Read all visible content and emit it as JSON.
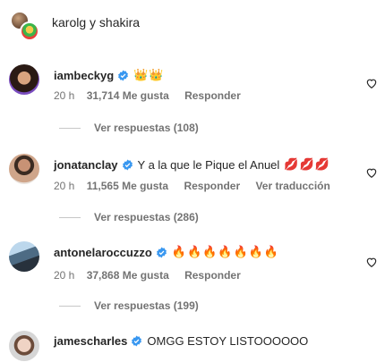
{
  "header": {
    "title": "karolg y shakira"
  },
  "comments": [
    {
      "username": "iambeckyg",
      "text": "",
      "emoji": "👑👑",
      "time": "20 h",
      "likes": "31,714 Me gusta",
      "reply": "Responder",
      "translate": "",
      "replies": "Ver respuestas (108)"
    },
    {
      "username": "jonatanclay",
      "text": "Y a la que le Pique el Anuel",
      "emoji": "💋💋💋",
      "time": "20 h",
      "likes": "11,565 Me gusta",
      "reply": "Responder",
      "translate": "Ver traducción",
      "replies": "Ver respuestas (286)"
    },
    {
      "username": "antonelaroccuzzo",
      "text": "",
      "emoji": "🔥🔥🔥🔥🔥🔥🔥",
      "time": "20 h",
      "likes": "37,868 Me gusta",
      "reply": "Responder",
      "translate": "",
      "replies": "Ver respuestas (199)"
    },
    {
      "username": "jamescharles",
      "text": "OMGG ESTOY LISTOOOOOO",
      "emoji": ""
    }
  ],
  "icons": {
    "verified_color": "#3897f0",
    "heart": "heart-outline-icon"
  }
}
